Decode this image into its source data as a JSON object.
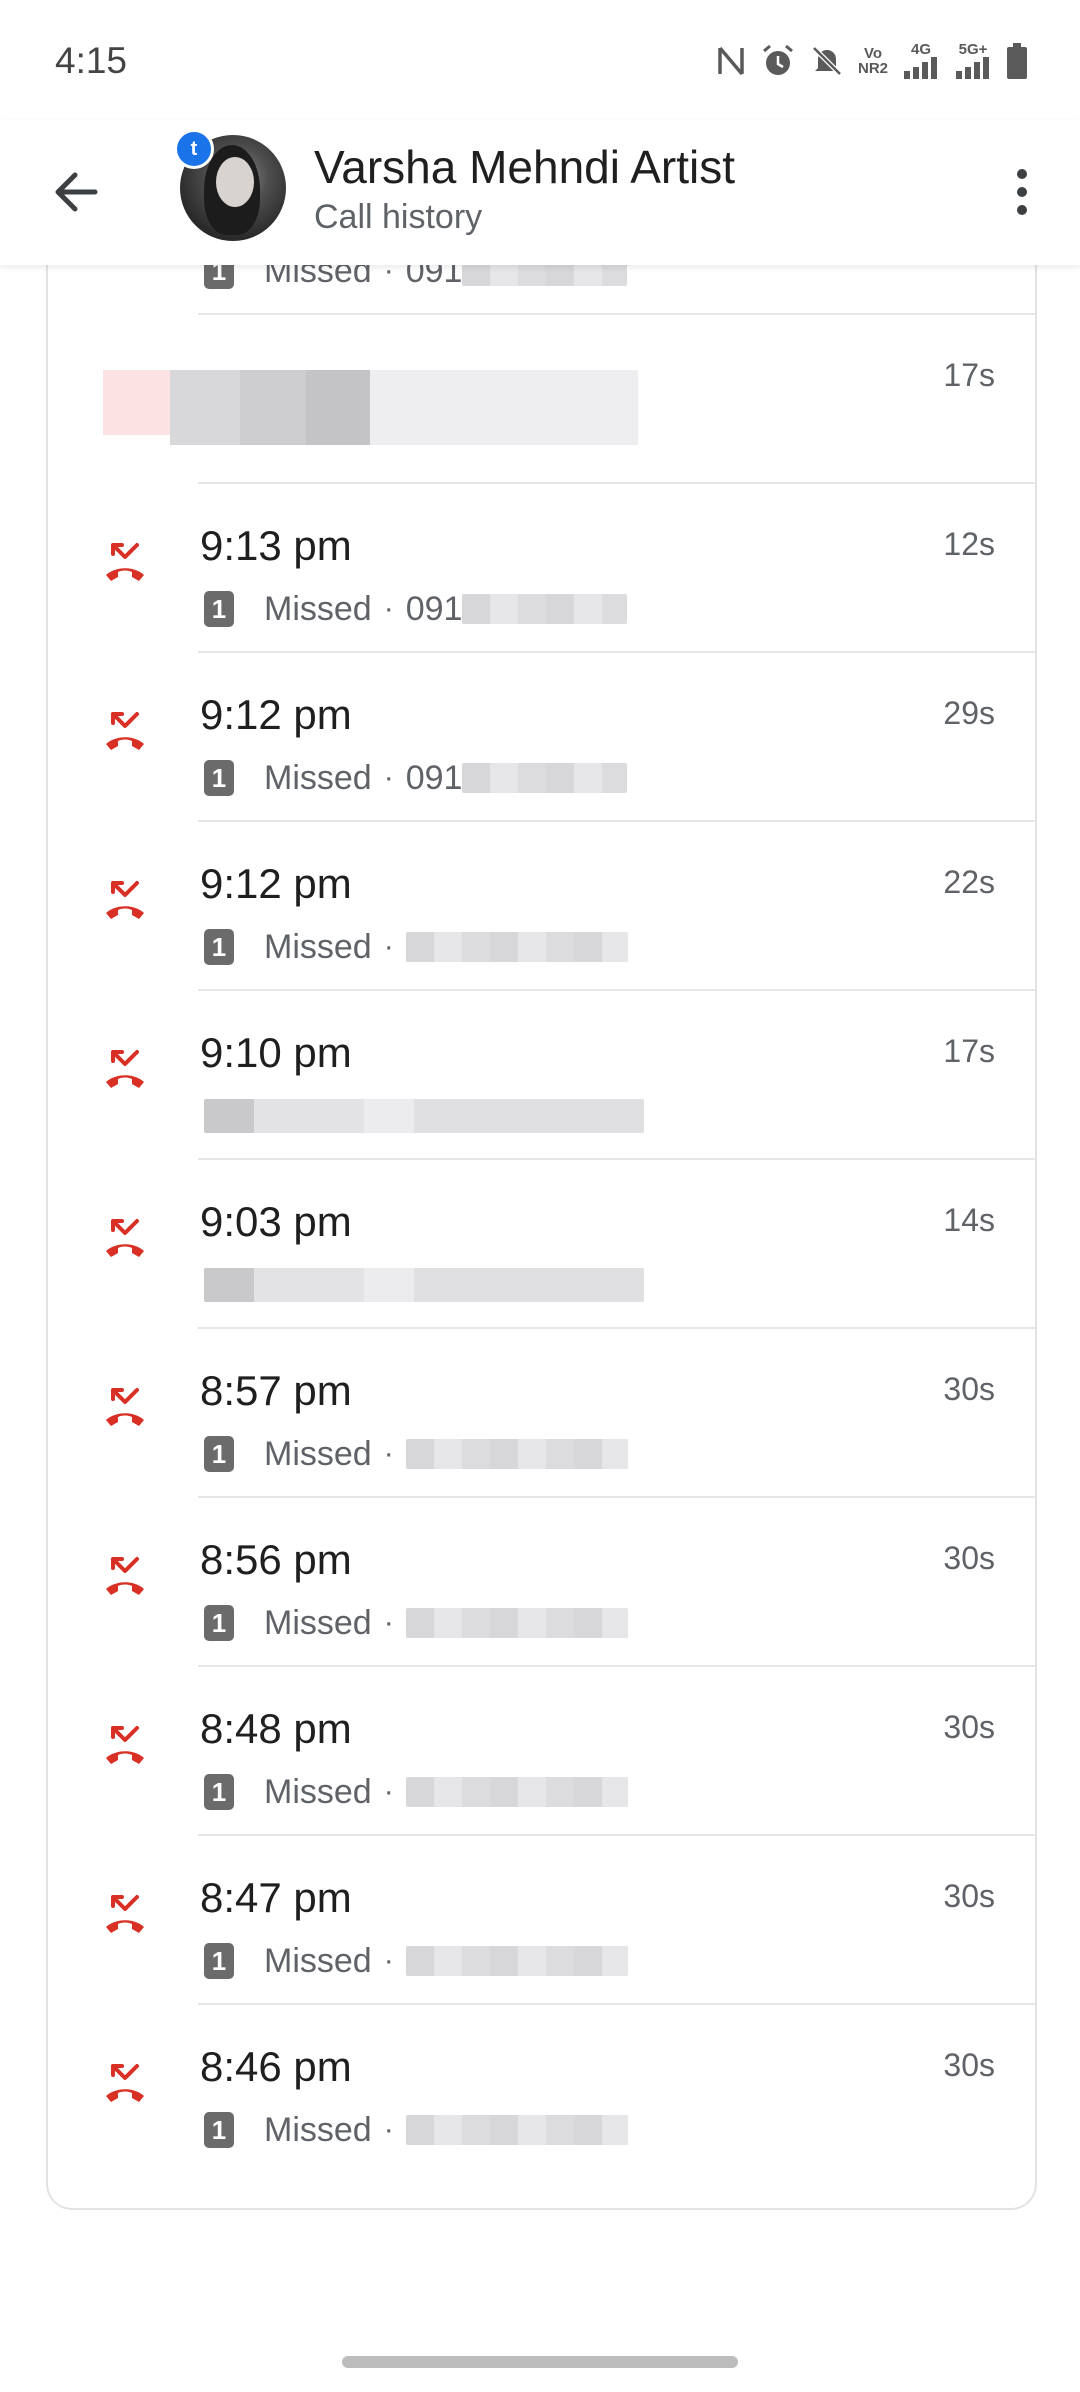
{
  "status_bar": {
    "time": "4:15",
    "icons": [
      "nfc-icon",
      "alarm-icon",
      "mute-icon",
      "volte-icon",
      "signal-4g-icon",
      "signal-5g-icon",
      "battery-icon"
    ],
    "volte_label": "Vo\nNR2",
    "net1_label": "4G",
    "net2_label": "5G+"
  },
  "header": {
    "contact_name": "Varsha Mehndi Artist",
    "subtitle": "Call history",
    "badge_letter": "t"
  },
  "calls": [
    {
      "time": "",
      "duration": "",
      "status": "Missed",
      "number": "091",
      "partial": true
    },
    {
      "time": "",
      "duration": "17s",
      "status": "",
      "number": "",
      "obscured": true
    },
    {
      "time": "9:13 pm",
      "duration": "12s",
      "status": "Missed",
      "number": "091"
    },
    {
      "time": "9:12 pm",
      "duration": "29s",
      "status": "Missed",
      "number": "091"
    },
    {
      "time": "9:12 pm",
      "duration": "22s",
      "status": "Missed",
      "number": ""
    },
    {
      "time": "9:10 pm",
      "duration": "17s",
      "status": "",
      "number": ""
    },
    {
      "time": "9:03 pm",
      "duration": "14s",
      "status": "",
      "number": ""
    },
    {
      "time": "8:57 pm",
      "duration": "30s",
      "status": "Missed",
      "number": ""
    },
    {
      "time": "8:56 pm",
      "duration": "30s",
      "status": "Missed",
      "number": ""
    },
    {
      "time": "8:48 pm",
      "duration": "30s",
      "status": "Missed",
      "number": ""
    },
    {
      "time": "8:47 pm",
      "duration": "30s",
      "status": "Missed",
      "number": ""
    },
    {
      "time": "8:46 pm",
      "duration": "30s",
      "status": "Missed",
      "number": ""
    }
  ],
  "sim_label": "1",
  "colors": {
    "missed_red": "#d93025",
    "text_primary": "#1f1f1f",
    "text_secondary": "#5f6368",
    "badge_blue": "#1a73e8"
  }
}
